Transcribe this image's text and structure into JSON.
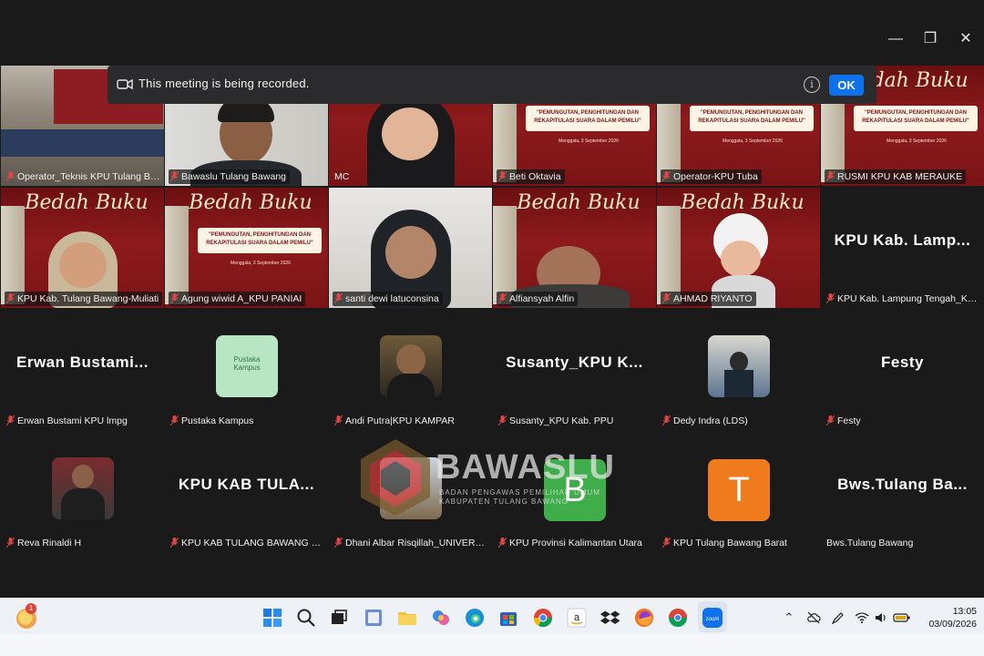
{
  "window": {
    "minimize": "—",
    "maximize": "❐",
    "close": "✕"
  },
  "recording": {
    "text": "This meeting is being recorded.",
    "ok_label": "OK",
    "info_glyph": "i"
  },
  "bedah": {
    "title": "Bedah Buku",
    "tema": "\"PEMUNGUTAN, PENGHITUNGAN DAN REKAPITULASI SUARA DALAM PEMILU\"",
    "date": "Menggala, 3 September 2026"
  },
  "participants": [
    {
      "name": "Operator_Teknis KPU Tulang Bawang"
    },
    {
      "name": "Bawaslu Tulang Bawang"
    },
    {
      "name": "MC"
    },
    {
      "name": "Beti Oktavia"
    },
    {
      "name": "Operator-KPU Tuba"
    },
    {
      "name": "RUSMI KPU KAB MERAUKE"
    },
    {
      "name": "KPU Kab. Tulang Bawang-Muliati"
    },
    {
      "name": "Agung wiwid A_KPU PANIAI"
    },
    {
      "name": "santi dewi latuconsina"
    },
    {
      "name": "Alfiansyah Alfin"
    },
    {
      "name": "AHMAD RIYANTO"
    },
    {
      "name": "KPU Kab. Lampung Tengah_Kasubag",
      "display": "KPU Kab. Lamp..."
    },
    {
      "name": "Erwan Bustami KPU lmpg",
      "display": "Erwan Bustami..."
    },
    {
      "name": "Pustaka Kampus",
      "thumb_text": "Pustaka Kampus"
    },
    {
      "name": "Andi Putra|KPU KAMPAR"
    },
    {
      "name": "Susanty_KPU Kab. PPU",
      "display": "Susanty_KPU K..."
    },
    {
      "name": "Dedy Indra (LDS)"
    },
    {
      "name": "Festy",
      "display": "Festy"
    },
    {
      "name": "Reva Rinaldi H"
    },
    {
      "name": "KPU KAB TULANG BAWANG BARAT",
      "display": "KPU KAB TULA..."
    },
    {
      "name": "Dhani Albar Risqillah_UNIVERSITAS"
    },
    {
      "name": "KPU Provinsi Kalimantan Utara",
      "letter": "B"
    },
    {
      "name": "KPU Tulang Bawang Barat",
      "letter": "T"
    },
    {
      "name": "Bws.Tulang Bawang",
      "display": "Bws.Tulang Ba..."
    }
  ],
  "watermark": {
    "brand": "BAWASLU",
    "sub1": "BADAN PENGAWAS PEMILIHAN UMUM",
    "sub2": "KABUPATEN TULANG BAWANG"
  },
  "taskbar": {
    "weather_badge": "1",
    "time": "13:05",
    "date": "03/09/2026"
  },
  "colors": {
    "accent": "#0e72ed",
    "active_speaker": "#23d959",
    "letter_b": "#3fae4a",
    "letter_t": "#f07b1c"
  }
}
